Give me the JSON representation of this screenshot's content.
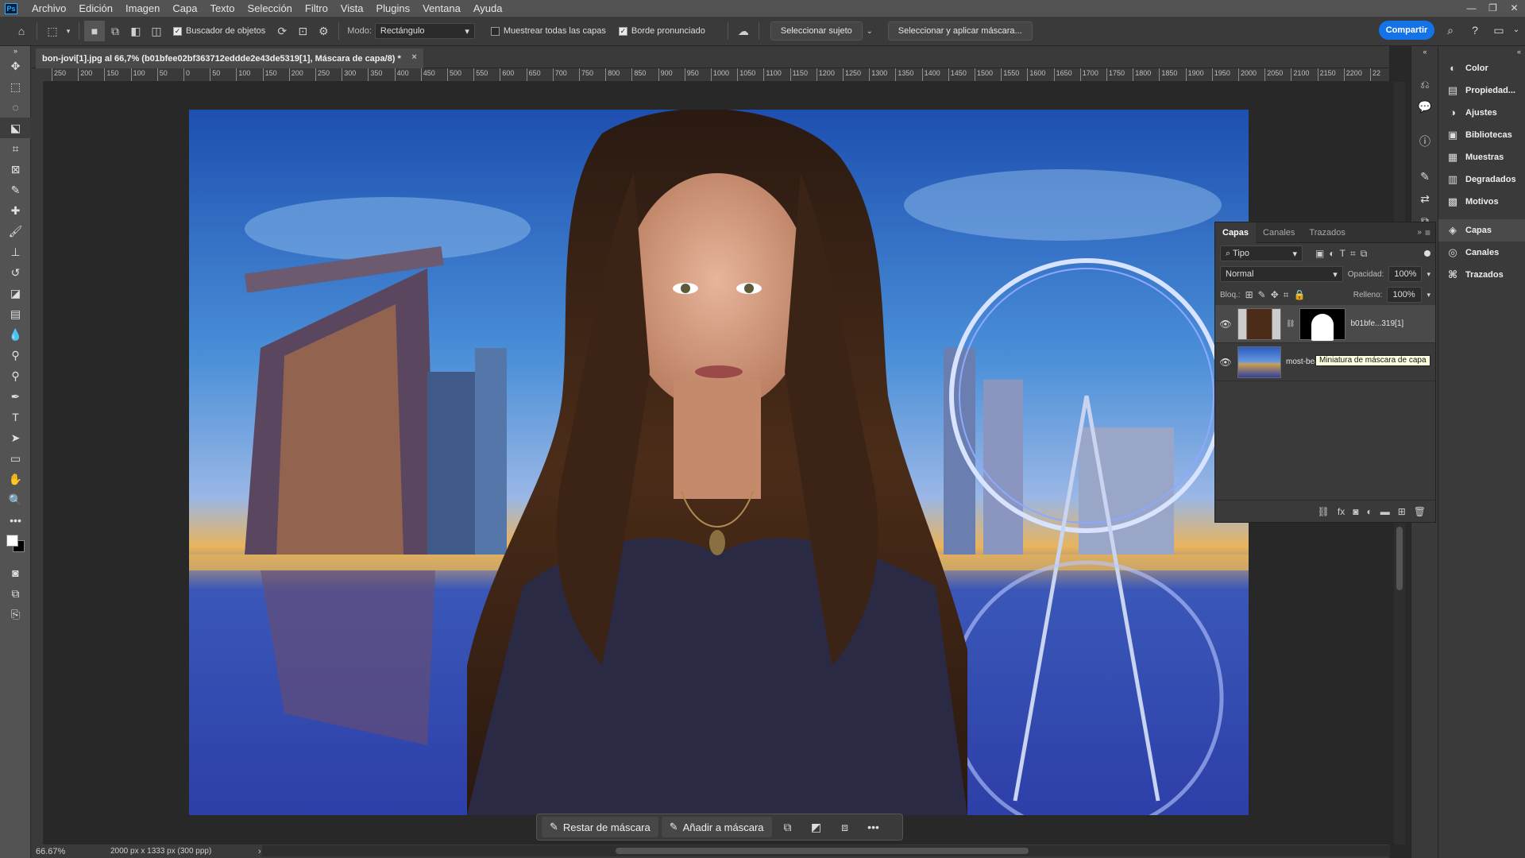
{
  "menubar": {
    "logo": "Ps",
    "items": [
      "Archivo",
      "Edición",
      "Imagen",
      "Capa",
      "Texto",
      "Selección",
      "Filtro",
      "Vista",
      "Plugins",
      "Ventana",
      "Ayuda"
    ]
  },
  "options": {
    "object_finder_label": "Buscador de objetos",
    "mode_label": "Modo:",
    "mode_value": "Rectángulo",
    "sample_all_label": "Muestrear todas las capas",
    "hard_edge_label": "Borde pronunciado",
    "select_subject_label": "Seleccionar sujeto",
    "select_mask_label": "Seleccionar y aplicar máscara...",
    "share_label": "Compartir"
  },
  "document": {
    "tab_title": "bon-jovi[1].jpg al 66,7% (b01bfee02bf363712eddde2e43de5319[1], Máscara de capa/8) *",
    "close_icon": "×"
  },
  "ruler": {
    "ticks": [
      "250",
      "200",
      "150",
      "100",
      "50",
      "0",
      "50",
      "100",
      "150",
      "200",
      "250",
      "300",
      "350",
      "400",
      "450",
      "500",
      "550",
      "600",
      "650",
      "700",
      "750",
      "800",
      "850",
      "900",
      "950",
      "1000",
      "1050",
      "1100",
      "1150",
      "1200",
      "1250",
      "1300",
      "1350",
      "1400",
      "1450",
      "1500",
      "1550",
      "1600",
      "1650",
      "1700",
      "1750",
      "1800",
      "1850",
      "1900",
      "1950",
      "2000",
      "2050",
      "2100",
      "2150",
      "2200",
      "22"
    ]
  },
  "status": {
    "zoom": "66.67%",
    "doc_size": "2000 px x 1333 px (300 ppp)"
  },
  "taskbar": {
    "subtract_label": "Restar de máscara",
    "add_label": "Añadir a máscara"
  },
  "layers_panel": {
    "tabs": [
      "Capas",
      "Canales",
      "Trazados"
    ],
    "filter_value": "Tipo",
    "blend_mode": "Normal",
    "opacity_label": "Opacidad:",
    "opacity_value": "100%",
    "lock_label": "Bloq.:",
    "fill_label": "Relleno:",
    "fill_value": "100%",
    "layers": [
      {
        "name": "b01bfe...319[1]",
        "visible": true
      },
      {
        "name": "most-beautiful-...apore-cr-getty",
        "visible": true
      }
    ],
    "tooltip": "Miniatura de máscara de capa"
  },
  "panel_list": {
    "items": [
      "Color",
      "Propiedad...",
      "Ajustes",
      "Bibliotecas",
      "Muestras",
      "Degradados",
      "Motivos",
      "Capas",
      "Canales",
      "Trazados"
    ]
  },
  "colors": {
    "accent": "#1473e6",
    "menubar": "#535353",
    "panel": "#3a3a3a",
    "canvas_bg": "#282828"
  }
}
